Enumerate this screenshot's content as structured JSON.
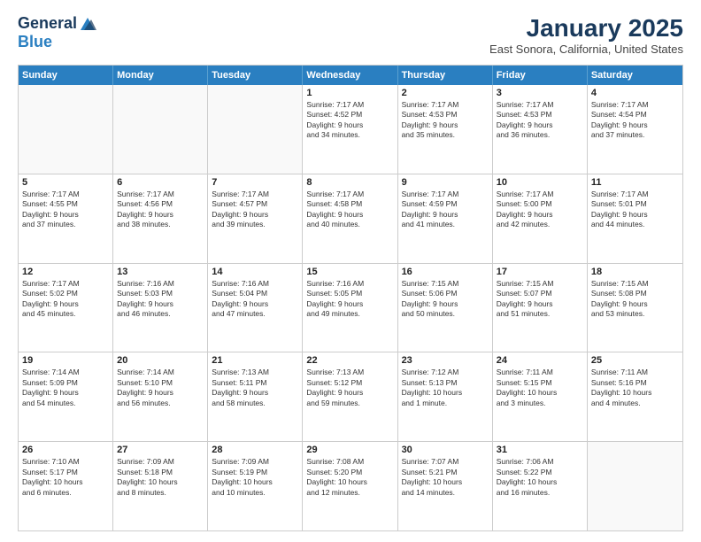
{
  "logo": {
    "general": "General",
    "blue": "Blue"
  },
  "header": {
    "month": "January 2025",
    "location": "East Sonora, California, United States"
  },
  "days": [
    "Sunday",
    "Monday",
    "Tuesday",
    "Wednesday",
    "Thursday",
    "Friday",
    "Saturday"
  ],
  "weeks": [
    [
      {
        "day": "",
        "content": ""
      },
      {
        "day": "",
        "content": ""
      },
      {
        "day": "",
        "content": ""
      },
      {
        "day": "1",
        "content": "Sunrise: 7:17 AM\nSunset: 4:52 PM\nDaylight: 9 hours\nand 34 minutes."
      },
      {
        "day": "2",
        "content": "Sunrise: 7:17 AM\nSunset: 4:53 PM\nDaylight: 9 hours\nand 35 minutes."
      },
      {
        "day": "3",
        "content": "Sunrise: 7:17 AM\nSunset: 4:53 PM\nDaylight: 9 hours\nand 36 minutes."
      },
      {
        "day": "4",
        "content": "Sunrise: 7:17 AM\nSunset: 4:54 PM\nDaylight: 9 hours\nand 37 minutes."
      }
    ],
    [
      {
        "day": "5",
        "content": "Sunrise: 7:17 AM\nSunset: 4:55 PM\nDaylight: 9 hours\nand 37 minutes."
      },
      {
        "day": "6",
        "content": "Sunrise: 7:17 AM\nSunset: 4:56 PM\nDaylight: 9 hours\nand 38 minutes."
      },
      {
        "day": "7",
        "content": "Sunrise: 7:17 AM\nSunset: 4:57 PM\nDaylight: 9 hours\nand 39 minutes."
      },
      {
        "day": "8",
        "content": "Sunrise: 7:17 AM\nSunset: 4:58 PM\nDaylight: 9 hours\nand 40 minutes."
      },
      {
        "day": "9",
        "content": "Sunrise: 7:17 AM\nSunset: 4:59 PM\nDaylight: 9 hours\nand 41 minutes."
      },
      {
        "day": "10",
        "content": "Sunrise: 7:17 AM\nSunset: 5:00 PM\nDaylight: 9 hours\nand 42 minutes."
      },
      {
        "day": "11",
        "content": "Sunrise: 7:17 AM\nSunset: 5:01 PM\nDaylight: 9 hours\nand 44 minutes."
      }
    ],
    [
      {
        "day": "12",
        "content": "Sunrise: 7:17 AM\nSunset: 5:02 PM\nDaylight: 9 hours\nand 45 minutes."
      },
      {
        "day": "13",
        "content": "Sunrise: 7:16 AM\nSunset: 5:03 PM\nDaylight: 9 hours\nand 46 minutes."
      },
      {
        "day": "14",
        "content": "Sunrise: 7:16 AM\nSunset: 5:04 PM\nDaylight: 9 hours\nand 47 minutes."
      },
      {
        "day": "15",
        "content": "Sunrise: 7:16 AM\nSunset: 5:05 PM\nDaylight: 9 hours\nand 49 minutes."
      },
      {
        "day": "16",
        "content": "Sunrise: 7:15 AM\nSunset: 5:06 PM\nDaylight: 9 hours\nand 50 minutes."
      },
      {
        "day": "17",
        "content": "Sunrise: 7:15 AM\nSunset: 5:07 PM\nDaylight: 9 hours\nand 51 minutes."
      },
      {
        "day": "18",
        "content": "Sunrise: 7:15 AM\nSunset: 5:08 PM\nDaylight: 9 hours\nand 53 minutes."
      }
    ],
    [
      {
        "day": "19",
        "content": "Sunrise: 7:14 AM\nSunset: 5:09 PM\nDaylight: 9 hours\nand 54 minutes."
      },
      {
        "day": "20",
        "content": "Sunrise: 7:14 AM\nSunset: 5:10 PM\nDaylight: 9 hours\nand 56 minutes."
      },
      {
        "day": "21",
        "content": "Sunrise: 7:13 AM\nSunset: 5:11 PM\nDaylight: 9 hours\nand 58 minutes."
      },
      {
        "day": "22",
        "content": "Sunrise: 7:13 AM\nSunset: 5:12 PM\nDaylight: 9 hours\nand 59 minutes."
      },
      {
        "day": "23",
        "content": "Sunrise: 7:12 AM\nSunset: 5:13 PM\nDaylight: 10 hours\nand 1 minute."
      },
      {
        "day": "24",
        "content": "Sunrise: 7:11 AM\nSunset: 5:15 PM\nDaylight: 10 hours\nand 3 minutes."
      },
      {
        "day": "25",
        "content": "Sunrise: 7:11 AM\nSunset: 5:16 PM\nDaylight: 10 hours\nand 4 minutes."
      }
    ],
    [
      {
        "day": "26",
        "content": "Sunrise: 7:10 AM\nSunset: 5:17 PM\nDaylight: 10 hours\nand 6 minutes."
      },
      {
        "day": "27",
        "content": "Sunrise: 7:09 AM\nSunset: 5:18 PM\nDaylight: 10 hours\nand 8 minutes."
      },
      {
        "day": "28",
        "content": "Sunrise: 7:09 AM\nSunset: 5:19 PM\nDaylight: 10 hours\nand 10 minutes."
      },
      {
        "day": "29",
        "content": "Sunrise: 7:08 AM\nSunset: 5:20 PM\nDaylight: 10 hours\nand 12 minutes."
      },
      {
        "day": "30",
        "content": "Sunrise: 7:07 AM\nSunset: 5:21 PM\nDaylight: 10 hours\nand 14 minutes."
      },
      {
        "day": "31",
        "content": "Sunrise: 7:06 AM\nSunset: 5:22 PM\nDaylight: 10 hours\nand 16 minutes."
      },
      {
        "day": "",
        "content": ""
      }
    ]
  ]
}
